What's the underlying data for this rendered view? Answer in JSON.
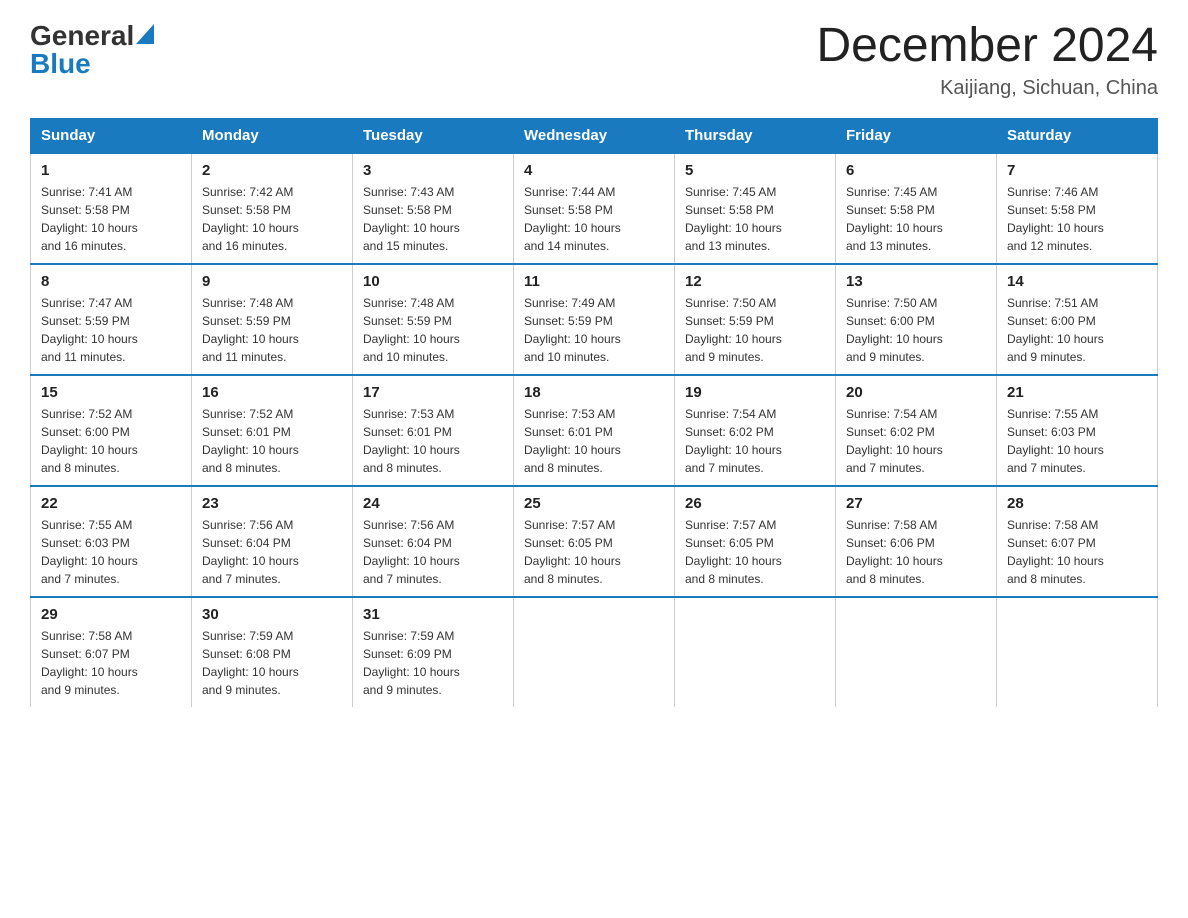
{
  "header": {
    "logo_general": "General",
    "logo_blue": "Blue",
    "month_title": "December 2024",
    "location": "Kaijiang, Sichuan, China"
  },
  "weekdays": [
    "Sunday",
    "Monday",
    "Tuesday",
    "Wednesday",
    "Thursday",
    "Friday",
    "Saturday"
  ],
  "weeks": [
    [
      {
        "day": "1",
        "sunrise": "7:41 AM",
        "sunset": "5:58 PM",
        "daylight": "10 hours and 16 minutes."
      },
      {
        "day": "2",
        "sunrise": "7:42 AM",
        "sunset": "5:58 PM",
        "daylight": "10 hours and 16 minutes."
      },
      {
        "day": "3",
        "sunrise": "7:43 AM",
        "sunset": "5:58 PM",
        "daylight": "10 hours and 15 minutes."
      },
      {
        "day": "4",
        "sunrise": "7:44 AM",
        "sunset": "5:58 PM",
        "daylight": "10 hours and 14 minutes."
      },
      {
        "day": "5",
        "sunrise": "7:45 AM",
        "sunset": "5:58 PM",
        "daylight": "10 hours and 13 minutes."
      },
      {
        "day": "6",
        "sunrise": "7:45 AM",
        "sunset": "5:58 PM",
        "daylight": "10 hours and 13 minutes."
      },
      {
        "day": "7",
        "sunrise": "7:46 AM",
        "sunset": "5:58 PM",
        "daylight": "10 hours and 12 minutes."
      }
    ],
    [
      {
        "day": "8",
        "sunrise": "7:47 AM",
        "sunset": "5:59 PM",
        "daylight": "10 hours and 11 minutes."
      },
      {
        "day": "9",
        "sunrise": "7:48 AM",
        "sunset": "5:59 PM",
        "daylight": "10 hours and 11 minutes."
      },
      {
        "day": "10",
        "sunrise": "7:48 AM",
        "sunset": "5:59 PM",
        "daylight": "10 hours and 10 minutes."
      },
      {
        "day": "11",
        "sunrise": "7:49 AM",
        "sunset": "5:59 PM",
        "daylight": "10 hours and 10 minutes."
      },
      {
        "day": "12",
        "sunrise": "7:50 AM",
        "sunset": "5:59 PM",
        "daylight": "10 hours and 9 minutes."
      },
      {
        "day": "13",
        "sunrise": "7:50 AM",
        "sunset": "6:00 PM",
        "daylight": "10 hours and 9 minutes."
      },
      {
        "day": "14",
        "sunrise": "7:51 AM",
        "sunset": "6:00 PM",
        "daylight": "10 hours and 9 minutes."
      }
    ],
    [
      {
        "day": "15",
        "sunrise": "7:52 AM",
        "sunset": "6:00 PM",
        "daylight": "10 hours and 8 minutes."
      },
      {
        "day": "16",
        "sunrise": "7:52 AM",
        "sunset": "6:01 PM",
        "daylight": "10 hours and 8 minutes."
      },
      {
        "day": "17",
        "sunrise": "7:53 AM",
        "sunset": "6:01 PM",
        "daylight": "10 hours and 8 minutes."
      },
      {
        "day": "18",
        "sunrise": "7:53 AM",
        "sunset": "6:01 PM",
        "daylight": "10 hours and 8 minutes."
      },
      {
        "day": "19",
        "sunrise": "7:54 AM",
        "sunset": "6:02 PM",
        "daylight": "10 hours and 7 minutes."
      },
      {
        "day": "20",
        "sunrise": "7:54 AM",
        "sunset": "6:02 PM",
        "daylight": "10 hours and 7 minutes."
      },
      {
        "day": "21",
        "sunrise": "7:55 AM",
        "sunset": "6:03 PM",
        "daylight": "10 hours and 7 minutes."
      }
    ],
    [
      {
        "day": "22",
        "sunrise": "7:55 AM",
        "sunset": "6:03 PM",
        "daylight": "10 hours and 7 minutes."
      },
      {
        "day": "23",
        "sunrise": "7:56 AM",
        "sunset": "6:04 PM",
        "daylight": "10 hours and 7 minutes."
      },
      {
        "day": "24",
        "sunrise": "7:56 AM",
        "sunset": "6:04 PM",
        "daylight": "10 hours and 7 minutes."
      },
      {
        "day": "25",
        "sunrise": "7:57 AM",
        "sunset": "6:05 PM",
        "daylight": "10 hours and 8 minutes."
      },
      {
        "day": "26",
        "sunrise": "7:57 AM",
        "sunset": "6:05 PM",
        "daylight": "10 hours and 8 minutes."
      },
      {
        "day": "27",
        "sunrise": "7:58 AM",
        "sunset": "6:06 PM",
        "daylight": "10 hours and 8 minutes."
      },
      {
        "day": "28",
        "sunrise": "7:58 AM",
        "sunset": "6:07 PM",
        "daylight": "10 hours and 8 minutes."
      }
    ],
    [
      {
        "day": "29",
        "sunrise": "7:58 AM",
        "sunset": "6:07 PM",
        "daylight": "10 hours and 9 minutes."
      },
      {
        "day": "30",
        "sunrise": "7:59 AM",
        "sunset": "6:08 PM",
        "daylight": "10 hours and 9 minutes."
      },
      {
        "day": "31",
        "sunrise": "7:59 AM",
        "sunset": "6:09 PM",
        "daylight": "10 hours and 9 minutes."
      },
      null,
      null,
      null,
      null
    ]
  ],
  "labels": {
    "sunrise": "Sunrise:",
    "sunset": "Sunset:",
    "daylight": "Daylight:"
  }
}
